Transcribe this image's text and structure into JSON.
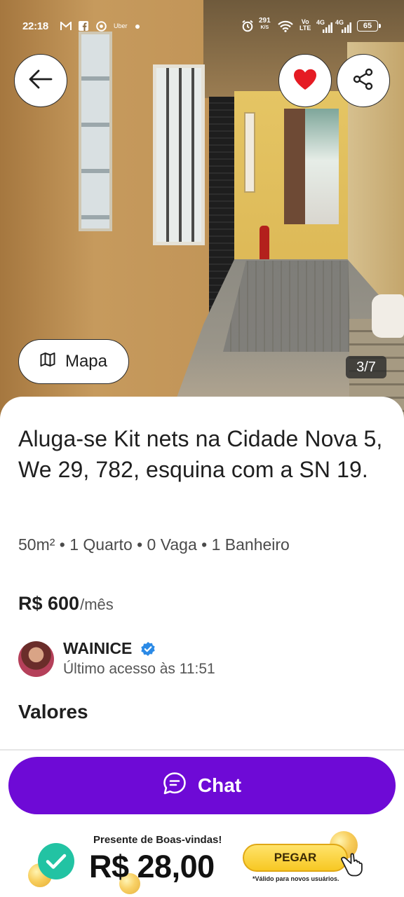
{
  "status_bar": {
    "time": "22:18",
    "app_icons": [
      "gmail-icon",
      "facebook-icon",
      "chrome-icon"
    ],
    "uber_label": "Uber",
    "speed_value": "291",
    "speed_unit": "K/S",
    "volte_top": "Vo",
    "volte_bottom": "LTE",
    "network_1": "4G",
    "network_2": "4G",
    "battery": "65"
  },
  "gallery": {
    "counter": "3/7",
    "map_label": "Mapa"
  },
  "listing": {
    "title": "Aluga-se Kit nets na Cidade Nova 5, We 29, 782, esquina com a SN 19.",
    "specs": "50m² • 1 Quarto • 0 Vaga • 1 Banheiro",
    "price": "R$ 600",
    "period": "/mês"
  },
  "seller": {
    "name": "WAINICE",
    "last_access": "Último acesso  às 11:51"
  },
  "sections": {
    "values_title": "Valores"
  },
  "actions": {
    "chat_label": "Chat"
  },
  "promo": {
    "label": "Presente de Boas-vindas!",
    "amount": "R$ 28,00",
    "button_label": "PEGAR",
    "note": "*Válido para novos usuários."
  },
  "colors": {
    "brand_purple": "#6e0ad6",
    "favorite_red": "#e51b23",
    "verified_blue": "#2b8ae6",
    "promo_yellow": "#f7c823",
    "check_green": "#22c3a3"
  }
}
